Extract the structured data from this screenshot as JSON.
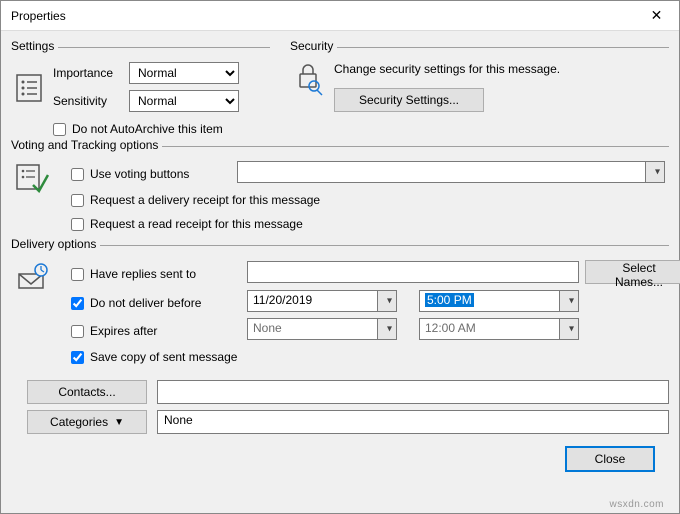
{
  "window": {
    "title": "Properties"
  },
  "settings": {
    "legend": "Settings",
    "importance_label": "Importance",
    "importance_value": "Normal",
    "sensitivity_label": "Sensitivity",
    "sensitivity_value": "Normal",
    "autoarchive_label": "Do not AutoArchive this item",
    "autoarchive_checked": false
  },
  "security": {
    "legend": "Security",
    "description": "Change security settings for this message.",
    "button": "Security Settings..."
  },
  "voting": {
    "legend": "Voting and Tracking options",
    "use_voting_label": "Use voting buttons",
    "use_voting_checked": false,
    "voting_value": "",
    "delivery_receipt_label": "Request a delivery receipt for this message",
    "delivery_receipt_checked": false,
    "read_receipt_label": "Request a read receipt for this message",
    "read_receipt_checked": false
  },
  "delivery": {
    "legend": "Delivery options",
    "have_replies_label": "Have replies sent to",
    "have_replies_checked": false,
    "have_replies_value": "",
    "select_names_button": "Select Names...",
    "do_not_deliver_label": "Do not deliver before",
    "do_not_deliver_checked": true,
    "do_not_deliver_date": "11/20/2019",
    "do_not_deliver_time": "5:00 PM",
    "expires_label": "Expires after",
    "expires_checked": false,
    "expires_date": "None",
    "expires_time": "12:00 AM",
    "save_copy_label": "Save copy of sent message",
    "save_copy_checked": true
  },
  "buttons": {
    "contacts": "Contacts...",
    "categories": "Categories",
    "categories_value": "None",
    "close": "Close"
  },
  "watermark": "wsxdn.com"
}
